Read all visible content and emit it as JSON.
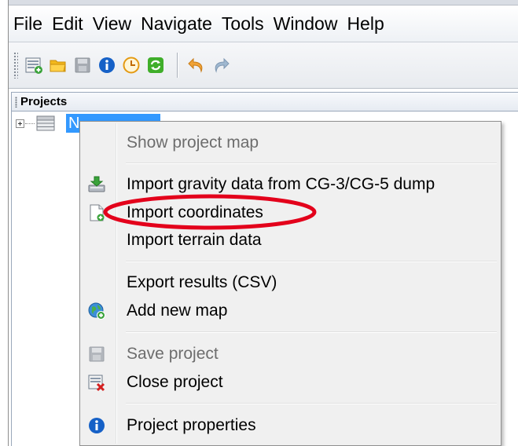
{
  "menubar": {
    "items": [
      "File",
      "Edit",
      "View",
      "Navigate",
      "Tools",
      "Window",
      "Help"
    ]
  },
  "toolbar": {
    "buttons": [
      {
        "icon": "new-project-icon"
      },
      {
        "icon": "open-folder-icon"
      },
      {
        "icon": "save-disk-icon"
      },
      {
        "icon": "info-icon"
      },
      {
        "icon": "clock-icon"
      },
      {
        "icon": "refresh-icon"
      },
      {
        "icon": "undo-icon"
      },
      {
        "icon": "redo-icon"
      }
    ]
  },
  "projects_panel": {
    "title": "Projects",
    "tree_node_label": "N"
  },
  "context_menu": {
    "items": [
      {
        "label": "Show project map",
        "enabled": false,
        "icon": null
      },
      {
        "label": "Import gravity data from CG-3/CG-5 dump",
        "enabled": true,
        "icon": "import-gravity-icon"
      },
      {
        "label": "Import coordinates",
        "enabled": true,
        "icon": "import-document-icon"
      },
      {
        "label": "Import terrain data",
        "enabled": true,
        "icon": null
      },
      {
        "label": "Export results (CSV)",
        "enabled": true,
        "icon": null
      },
      {
        "label": "Add new map",
        "enabled": true,
        "icon": "globe-add-icon"
      },
      {
        "label": "Save project",
        "enabled": false,
        "icon": "save-disk-icon"
      },
      {
        "label": "Close project",
        "enabled": true,
        "icon": "close-project-icon"
      },
      {
        "label": "Project properties",
        "enabled": true,
        "icon": "info-icon"
      }
    ]
  },
  "colors": {
    "selection": "#3399ff",
    "annotation": "#e3001b",
    "menu_background": "#f0f0f0"
  }
}
